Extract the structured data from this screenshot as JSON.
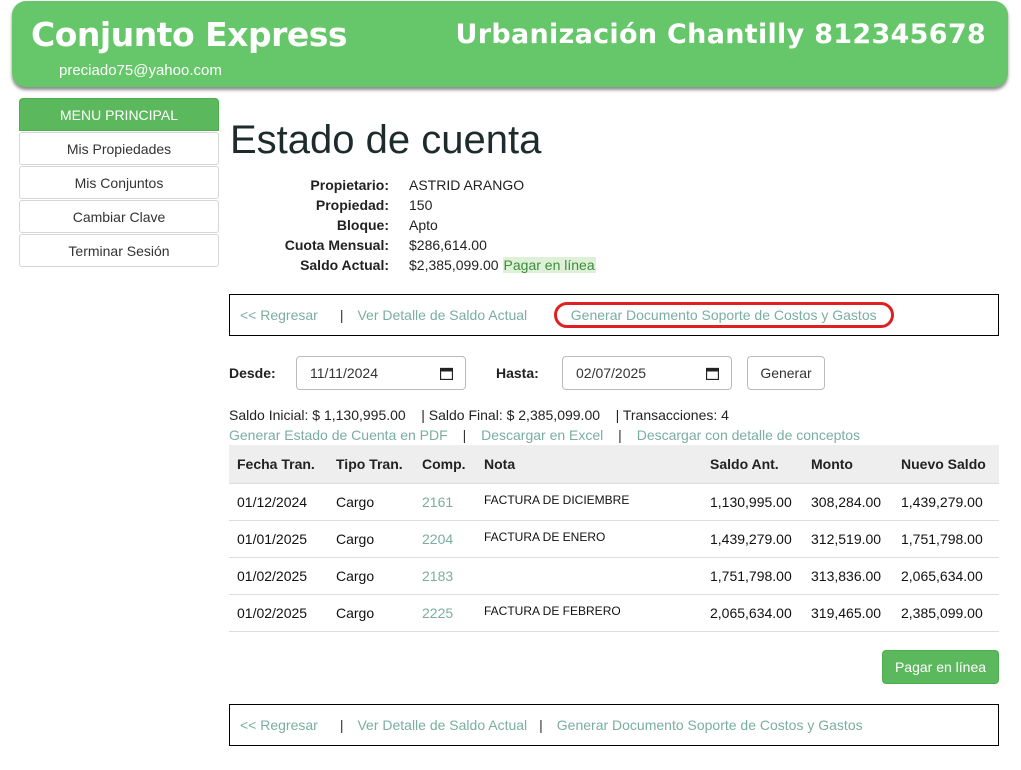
{
  "header": {
    "brand": "Conjunto Express",
    "right_title": "Urbanización Chantilly 812345678",
    "email": "preciado75@yahoo.com"
  },
  "sidebar": {
    "heading": "MENU PRINCIPAL",
    "items": [
      {
        "label": "Mis Propiedades"
      },
      {
        "label": "Mis Conjuntos"
      },
      {
        "label": "Cambiar Clave"
      },
      {
        "label": "Terminar Sesión"
      }
    ]
  },
  "page": {
    "title": "Estado de cuenta"
  },
  "info": {
    "propietario_label": "Propietario:",
    "propietario": "ASTRID ARANGO",
    "propiedad_label": "Propiedad:",
    "propiedad": "150",
    "bloque_label": "Bloque:",
    "bloque": "Apto",
    "cuota_label": "Cuota Mensual:",
    "cuota": "$286,614.00",
    "saldo_label": "Saldo Actual:",
    "saldo": "$2,385,099.00",
    "pay_link": "Pagar en línea"
  },
  "nav": {
    "back": "<< Regresar",
    "sep": "|",
    "detail": "Ver Detalle de Saldo Actual",
    "support_doc": "Generar Documento Soporte de Costos y Gastos"
  },
  "filter": {
    "desde_label": "Desde:",
    "desde_value": "11/11/2024",
    "hasta_label": "Hasta:",
    "hasta_value": "02/07/2025",
    "generate_label": "Generar"
  },
  "summary": {
    "text": "Saldo Inicial: $ 1,130,995.00    | Saldo Final: $ 2,385,099.00    | Transacciones: 4"
  },
  "downloads": {
    "pdf": "Generar Estado de Cuenta en PDF",
    "excel": "Descargar en Excel",
    "detail": "Descargar con detalle de conceptos",
    "sep": "|"
  },
  "table": {
    "headers": [
      "Fecha Tran.",
      "Tipo Tran.",
      "Comp.",
      "Nota",
      "Saldo Ant.",
      "Monto",
      "Nuevo Saldo"
    ],
    "rows": [
      [
        "01/12/2024",
        "Cargo",
        "2161",
        "FACTURA DE DICIEMBRE",
        "1,130,995.00",
        "308,284.00",
        "1,439,279.00"
      ],
      [
        "01/01/2025",
        "Cargo",
        "2204",
        "FACTURA DE ENERO",
        "1,439,279.00",
        "312,519.00",
        "1,751,798.00"
      ],
      [
        "01/02/2025",
        "Cargo",
        "2183",
        "",
        "1,751,798.00",
        "313,836.00",
        "2,065,634.00"
      ],
      [
        "01/02/2025",
        "Cargo",
        "2225",
        "FACTURA DE FEBRERO",
        "2,065,634.00",
        "319,465.00",
        "2,385,099.00"
      ]
    ]
  },
  "pay_button": "Pagar en línea",
  "colors": {
    "header_green": "#66c66a",
    "button_green": "#5cb85c",
    "link": "#7aaea0",
    "highlight": "#e02020"
  }
}
